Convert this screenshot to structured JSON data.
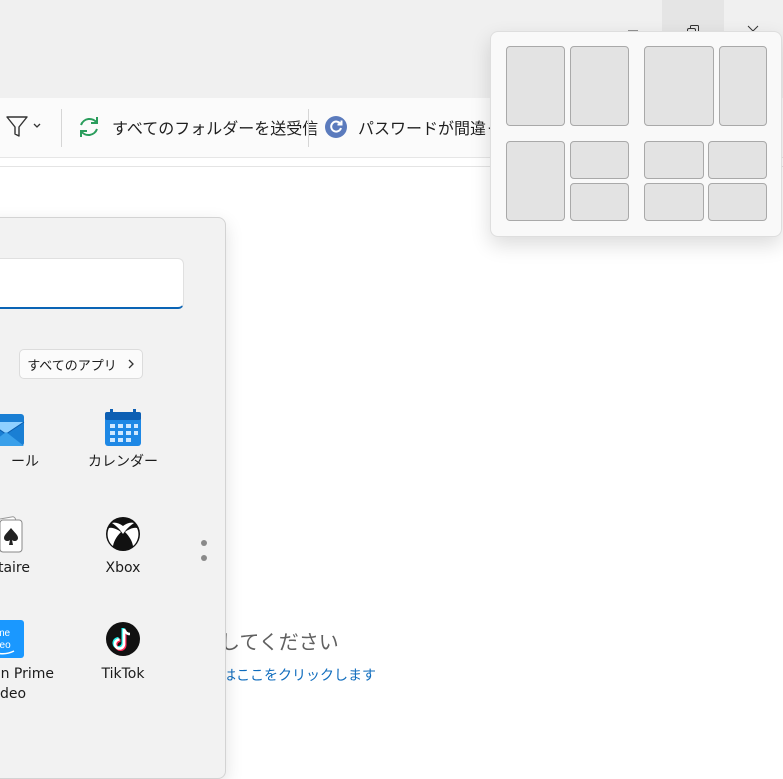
{
  "toolbar": {
    "filter_icon": "filter-icon",
    "send_receive_label": "すべてのフォルダーを送受信",
    "password_label": "パスワードが間違って"
  },
  "main": {
    "empty_text": "してください",
    "empty_link": "はここをクリックします"
  },
  "start_menu": {
    "search_placeholder": "",
    "all_apps_label": "すべてのアプリ",
    "apps": [
      {
        "label": "ール",
        "icon": "mail-icon"
      },
      {
        "label": "カレンダー",
        "icon": "calendar-icon"
      },
      {
        "label": "taire",
        "icon": "solitaire-icon"
      },
      {
        "label": "Xbox",
        "icon": "xbox-icon"
      },
      {
        "label": "on Prime",
        "label2": "deo",
        "icon": "prime-video-icon"
      },
      {
        "label": "TikTok",
        "icon": "tiktok-icon"
      }
    ]
  },
  "snap_layouts": {
    "layouts": [
      "two-column-equal",
      "two-column-wide-left",
      "left-plus-two-stacked",
      "four-grid"
    ]
  },
  "colors": {
    "accent": "#0a64b5",
    "link": "#0f6cbd",
    "send_receive_green": "#2a9d5c"
  }
}
